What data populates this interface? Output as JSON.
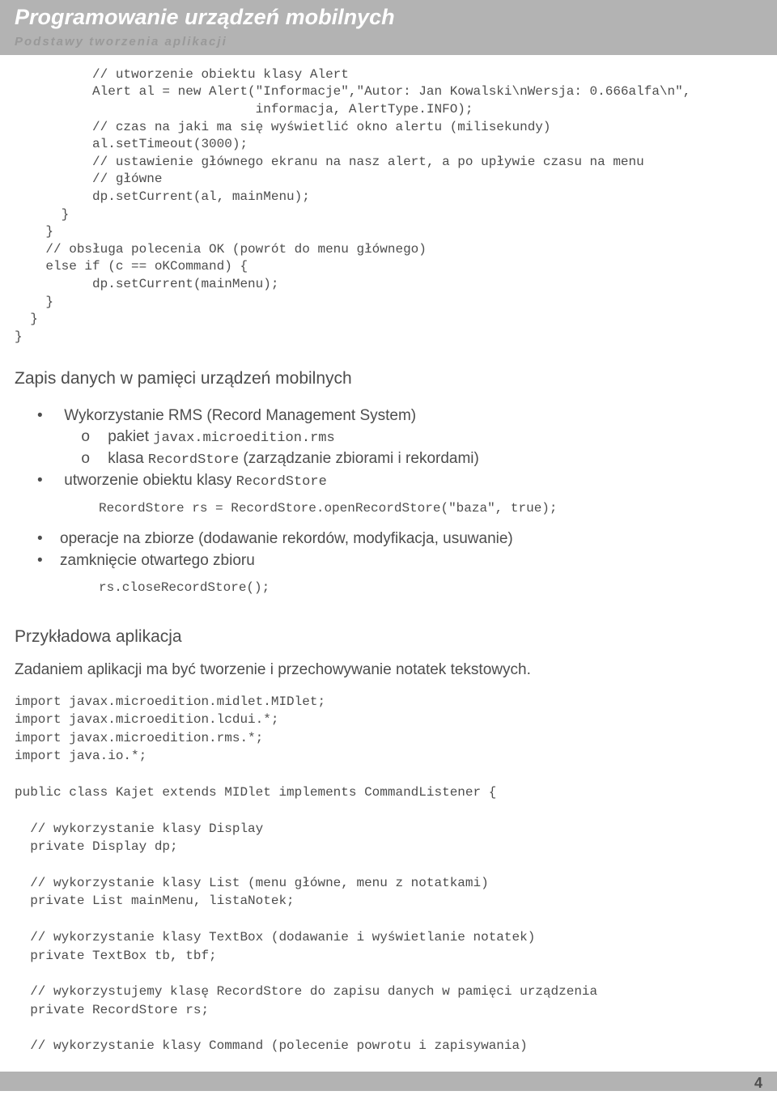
{
  "header": {
    "title": "Programowanie urządzeń mobilnych",
    "subtitle": "Podstawy tworzenia aplikacji"
  },
  "code1": "          // utworzenie obiektu klasy Alert\n          Alert al = new Alert(\"Informacje\",\"Autor: Jan Kowalski\\nWersja: 0.666alfa\\n\",\n                               informacja, AlertType.INFO);\n          // czas na jaki ma się wyświetlić okno alertu (milisekundy)\n          al.setTimeout(3000);\n          // ustawienie głównego ekranu na nasz alert, a po upływie czasu na menu\n          // główne\n          dp.setCurrent(al, mainMenu);\n      }\n    }\n    // obsługa polecenia OK (powrót do menu głównego)\n    else if (c == oKCommand) {\n          dp.setCurrent(mainMenu);\n    }\n  }\n}",
  "section1_title": "Zapis danych w pamięci urządzeń mobilnych",
  "bullets1": {
    "b0_prefix": "Wykorzystanie RMS (Record Management System)",
    "b0_n0_prefix": "pakiet ",
    "b0_n0_code": "javax.microedition.rms",
    "b0_n1_prefix": "klasa ",
    "b0_n1_code": "RecordStore",
    "b0_n1_suffix": " (zarządzanie zbiorami i rekordami)",
    "b1_prefix": "utworzenie obiektu klasy ",
    "b1_code": "RecordStore"
  },
  "code2": "RecordStore rs = RecordStore.openRecordStore(\"baza\", true);",
  "bullets2": {
    "b0": "operacje na zbiorze (dodawanie rekordów, modyfikacja, usuwanie)",
    "b1": "zamknięcie otwartego zbioru"
  },
  "code3": "rs.closeRecordStore();",
  "section2_title": "Przykładowa aplikacja",
  "section2_para": "Zadaniem aplikacji ma być tworzenie i przechowywanie notatek tekstowych.",
  "code4": "import javax.microedition.midlet.MIDlet;\nimport javax.microedition.lcdui.*;\nimport javax.microedition.rms.*;\nimport java.io.*;\n\npublic class Kajet extends MIDlet implements CommandListener {\n\n  // wykorzystanie klasy Display\n  private Display dp;\n\n  // wykorzystanie klasy List (menu główne, menu z notatkami)\n  private List mainMenu, listaNotek;\n\n  // wykorzystanie klasy TextBox (dodawanie i wyświetlanie notatek)\n  private TextBox tb, tbf;\n\n  // wykorzystujemy klasę RecordStore do zapisu danych w pamięci urządzenia\n  private RecordStore rs;\n\n  // wykorzystanie klasy Command (polecenie powrotu i zapisywania)",
  "page_number": "4"
}
